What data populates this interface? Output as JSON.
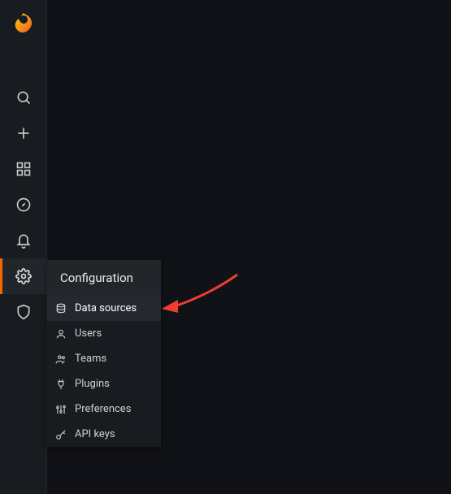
{
  "brand": {
    "name": "Grafana"
  },
  "sidebar": {
    "items": [
      {
        "name": "search-icon",
        "label": "Search"
      },
      {
        "name": "plus-icon",
        "label": "Create"
      },
      {
        "name": "dashboards-icon",
        "label": "Dashboards"
      },
      {
        "name": "explore-icon",
        "label": "Explore"
      },
      {
        "name": "alerting-icon",
        "label": "Alerting"
      },
      {
        "name": "gear-icon",
        "label": "Configuration"
      },
      {
        "name": "shield-icon",
        "label": "Server Admin"
      }
    ]
  },
  "configuration_menu": {
    "title": "Configuration",
    "items": [
      {
        "label": "Data sources",
        "active": true
      },
      {
        "label": "Users",
        "active": false
      },
      {
        "label": "Teams",
        "active": false
      },
      {
        "label": "Plugins",
        "active": false
      },
      {
        "label": "Preferences",
        "active": false
      },
      {
        "label": "API keys",
        "active": false
      }
    ]
  },
  "annotation": {
    "arrow_color": "#f03e2e"
  }
}
